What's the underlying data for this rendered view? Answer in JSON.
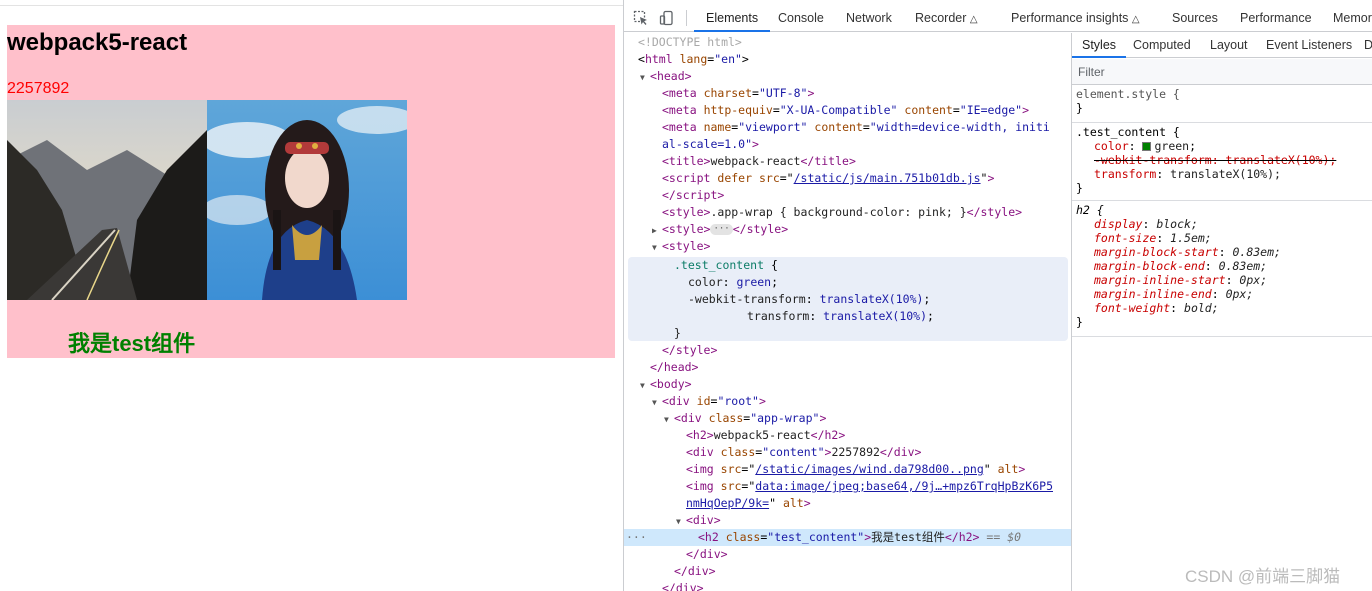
{
  "page": {
    "title": "webpack5-react",
    "content": "2257892",
    "test_text": "我是test组件",
    "bg_color": "#ffc0cb",
    "content_color": "#ff0000",
    "test_color": "#008000"
  },
  "devtools": {
    "tabs": [
      "Elements",
      "Console",
      "Network",
      "Recorder",
      "Performance insights",
      "Sources",
      "Performance",
      "Memor"
    ],
    "active_tab": "Elements",
    "tree": {
      "doctype": "<!DOCTYPE html>",
      "html_tag": "html",
      "html_attr_name": "lang",
      "html_attr_value": "\"en\"",
      "head": "head",
      "meta1_name": "charset",
      "meta1_value": "\"UTF-8\"",
      "meta2_name1": "http-equiv",
      "meta2_value1": "\"X-UA-Compatible\"",
      "meta2_name2": "content",
      "meta2_value2": "\"IE=edge\"",
      "meta3_name1": "name",
      "meta3_value1": "\"viewport\"",
      "meta3_name2": "content",
      "meta3_value2a": "\"width=device-width, initi",
      "meta3_value2b": "al-scale=1.0\"",
      "title_text": "webpack-react",
      "script_attr1": "defer",
      "script_attr2": "src",
      "script_src": "/static/js/main.751b01db.js",
      "style1_text": ".app-wrap { background-color: pink; }",
      "css_selector": ".test_content",
      "css_prop1": "color",
      "css_val1": "green",
      "css_prop2": "-webkit-transform",
      "css_prop3": "transform",
      "css_val2": "translateX(10%)",
      "div_id_value": "\"root\"",
      "app_wrap_class": "\"app-wrap\"",
      "h2_text": "webpack5-react",
      "content_class": "\"content\"",
      "content_text": "2257892",
      "img1_src": "/static/images/wind.da798d00..png",
      "img2_src_a": "data:image/jpeg;base64,/9j…+mpz6TrqHpBzK6P5",
      "img2_src_b": "nmHqOepP/9k=",
      "test_class": "\"test_content\"",
      "test_text": "我是test组件",
      "dollar0": "== $0"
    }
  },
  "styles_pane": {
    "tabs": [
      "Styles",
      "Computed",
      "Layout",
      "Event Listeners",
      "D"
    ],
    "filter_placeholder": "Filter",
    "element_style": "element.style {",
    "rule1_selector": ".test_content {",
    "rule1_color": "green",
    "rule1_webkit": "-webkit-transform: translateX(10%);",
    "rule1_transform": "translateX(10%);",
    "rule2_selector": "h2 {",
    "rule2_props": [
      [
        "display",
        "block;"
      ],
      [
        "font-size",
        "1.5em;"
      ],
      [
        "margin-block-start",
        "0.83em;"
      ],
      [
        "margin-block-end",
        "0.83em;"
      ],
      [
        "margin-inline-start",
        "0px;"
      ],
      [
        "margin-inline-end",
        "0px;"
      ],
      [
        "font-weight",
        "bold;"
      ]
    ]
  },
  "watermark": "CSDN @前端三脚猫"
}
